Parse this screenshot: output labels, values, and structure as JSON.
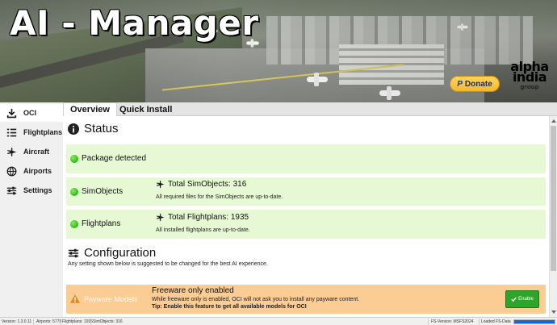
{
  "app": {
    "title": "AI - Manager"
  },
  "banner": {
    "donate_label": "Donate",
    "donate_brand": "P",
    "logo_line1": "alpha",
    "logo_line2": "india",
    "logo_line3": "group"
  },
  "sidebar": {
    "items": [
      {
        "label": "OCI",
        "icon": "download-icon",
        "active": true
      },
      {
        "label": "Flightplans",
        "icon": "list-icon",
        "active": false
      },
      {
        "label": "Aircraft",
        "icon": "plane-icon",
        "active": false
      },
      {
        "label": "Airports",
        "icon": "globe-icon",
        "active": false
      },
      {
        "label": "Settings",
        "icon": "sliders-icon",
        "active": false
      }
    ]
  },
  "tabs": [
    {
      "label": "Overview",
      "active": true
    },
    {
      "label": "Quick Install",
      "active": false
    }
  ],
  "status": {
    "heading": "Status",
    "cards": [
      {
        "label": "Package detected"
      },
      {
        "label": "SimObjects",
        "title": "Total SimObjects: 316",
        "sub": "All required files for the SimObjects are up-to-date."
      },
      {
        "label": "Flightplans",
        "title": "Total Flightplans: 1935",
        "sub": "All installed flightplans are up-to-date."
      }
    ]
  },
  "configuration": {
    "heading": "Configuration",
    "description": "Any setting shown below is suggested to be changed for the best AI experience.",
    "payware": {
      "label": "Payware Models",
      "title": "Freeware only enabled",
      "sub": "While freeware only is enabled, OCI will not ask you to install any payware content.",
      "tip": "Tip: Enable this feature to get all available models for OCI",
      "button_label": "Enable"
    }
  },
  "statusbar": {
    "version": "Version: 1.3.0.11",
    "airports": "Airports: 5778",
    "flightplans": "Flightplans: 1935",
    "simobjects": "SimObjects: 316",
    "fs_version": "FS-Version: MSFS2024",
    "loaded": "Loaded FS-Data",
    "progress": 1.0
  },
  "colors": {
    "status_ok": "#e6f9d4",
    "warning": "#fbcc94",
    "enable": "#2ea52a",
    "progress": "#1565d8"
  }
}
